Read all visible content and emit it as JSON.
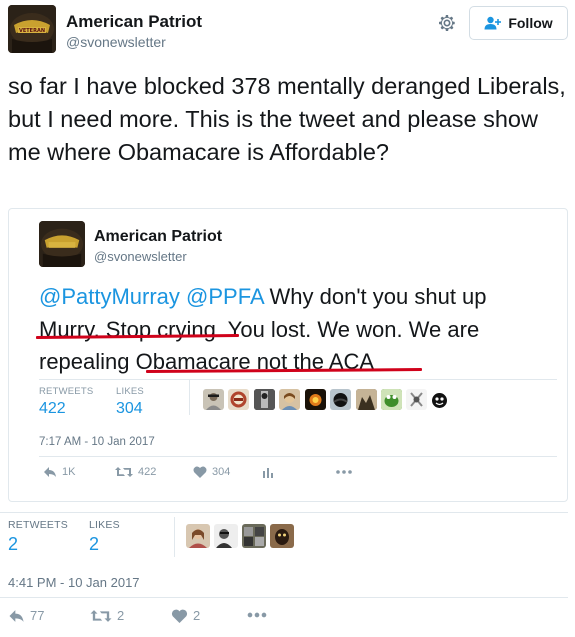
{
  "outer": {
    "name": "American Patriot",
    "handle": "@svonewsletter",
    "follow_label": "Follow",
    "text": "so far I have blocked 378 mentally deranged Liberals, but I need more. This is the tweet and please show me where Obamacare is Affordable?",
    "retweets_label": "RETWEETS",
    "retweets": "2",
    "likes_label": "LIKES",
    "likes": "2",
    "timestamp": "4:41 PM - 10 Jan 2017",
    "reply_count": "77",
    "retweet_count": "2",
    "like_count": "2",
    "avatar_text": "VETERAN"
  },
  "quoted": {
    "name": "American Patriot",
    "handle": "@svonewsletter",
    "mention1": "@PattyMurray",
    "mention2": "@PPFA",
    "line1_rest": " Why don't you shut up",
    "line2a": "Murry. Stop crying",
    "line2b": ". You lost. We won. We are",
    "line3a": "repealing ",
    "line3b": "Obamacare not the ACA",
    "retweets_label": "RETWEETS",
    "retweets": "422",
    "likes_label": "LIKES",
    "likes": "304",
    "timestamp": "7:17 AM - 10 Jan 2017",
    "reply_count": "1K",
    "retweet_count": "422",
    "like_count": "304"
  },
  "colors": {
    "link": "#1b95e0",
    "underline": "#d0021b",
    "muted": "#8899a6"
  },
  "icons": [
    "gear-icon",
    "follow-person-icon",
    "reply-icon",
    "retweet-icon",
    "heart-icon",
    "analytics-icon",
    "more-icon"
  ]
}
